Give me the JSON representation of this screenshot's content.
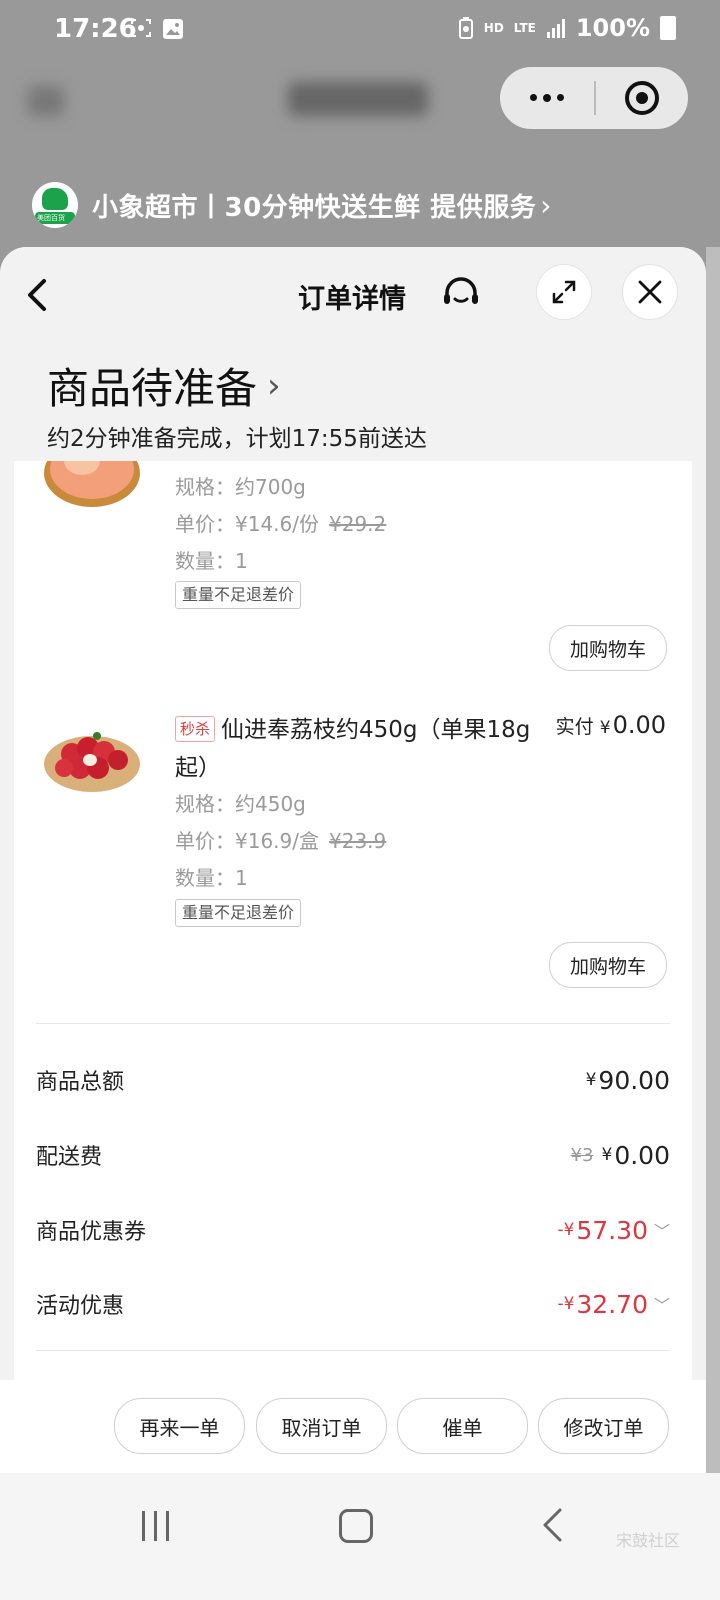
{
  "status_bar": {
    "time": "17:26",
    "network_hd": "HD",
    "network_lte": "LTE",
    "battery": "100%"
  },
  "provider": {
    "logo_text": "美团百货",
    "text": "小象超市丨30分钟快送生鲜 提供服务",
    "chevron": "›"
  },
  "header": {
    "title": "订单详情"
  },
  "order": {
    "status": "商品待准备",
    "status_chevron": "›",
    "subtitle": "约2分钟准备完成，计划17:55前送达"
  },
  "products": [
    {
      "spec": "规格：约700g",
      "unit_price": "单价：¥14.6/份",
      "original_price": "¥29.2",
      "quantity": "数量：1",
      "tag": "重量不足退差价",
      "cart_label": "加购物车"
    },
    {
      "flash_tag": "秒杀",
      "name": "仙进奉荔枝约450g（单果18g起）",
      "paid_label": "实付",
      "paid_currency": "¥",
      "paid_amount": "0.00",
      "spec": "规格：约450g",
      "unit_price": "单价：¥16.9/盒",
      "original_price": "¥23.9",
      "quantity": "数量：1",
      "tag": "重量不足退差价",
      "cart_label": "加购物车"
    }
  ],
  "summary": {
    "goods_total_label": "商品总额",
    "goods_total_currency": "¥",
    "goods_total_value": "90.00",
    "delivery_label": "配送费",
    "delivery_old": "¥3",
    "delivery_currency": "¥",
    "delivery_value": "0.00",
    "coupon_label": "商品优惠券",
    "coupon_prefix": "-¥",
    "coupon_value": "57.30",
    "activity_label": "活动优惠",
    "activity_prefix": "-¥",
    "activity_value": "32.70"
  },
  "actions": {
    "reorder": "再来一单",
    "cancel": "取消订单",
    "urge": "催单",
    "modify": "修改订单"
  },
  "watermark": "宋鼓社区",
  "colors": {
    "accent_red": "#e0353d",
    "brand_green": "#1aa34a"
  }
}
